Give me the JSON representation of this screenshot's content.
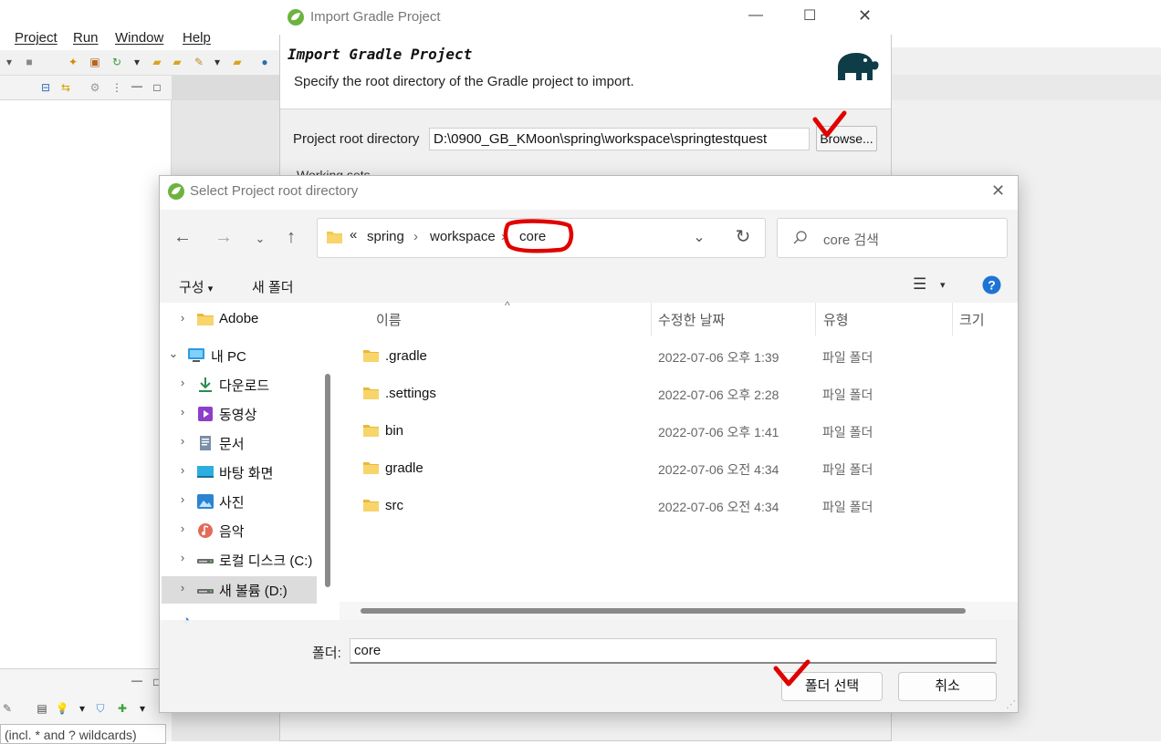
{
  "eclipse": {
    "menu": [
      "Project",
      "Run",
      "Window",
      "Help"
    ],
    "filter_text": "(incl. * and ? wildcards)"
  },
  "gradle_dialog": {
    "title": "Import Gradle Project",
    "heading": "Import Gradle Project",
    "description": "Specify the root directory of the Gradle project to import.",
    "root_label": "Project root directory",
    "root_value": "D:\\0900_GB_KMoon\\spring\\workspace\\springtestquest",
    "browse_label": "Browse...",
    "working_sets_label": "Working sets"
  },
  "folder_dialog": {
    "title": "Select Project root directory",
    "breadcrumb": {
      "overflow": "«",
      "items": [
        "spring",
        "workspace",
        "core"
      ]
    },
    "search_placeholder": "core 검색",
    "organize_label": "구성",
    "new_folder_label": "새 폴더",
    "nav_tree": [
      {
        "label": "Adobe",
        "icon": "folder-icon",
        "indent": 0
      },
      {
        "label": "내 PC",
        "icon": "computer-icon",
        "indent": 0,
        "expanded": true
      },
      {
        "label": "다운로드",
        "icon": "download-icon",
        "indent": 1
      },
      {
        "label": "동영상",
        "icon": "video-icon",
        "indent": 1
      },
      {
        "label": "문서",
        "icon": "document-icon",
        "indent": 1
      },
      {
        "label": "바탕 화면",
        "icon": "desktop-icon",
        "indent": 1
      },
      {
        "label": "사진",
        "icon": "pictures-icon",
        "indent": 1
      },
      {
        "label": "음악",
        "icon": "music-icon",
        "indent": 1
      },
      {
        "label": "로컬 디스크 (C:)",
        "icon": "drive-icon",
        "indent": 1
      },
      {
        "label": "새 볼륨 (D:)",
        "icon": "drive-icon",
        "indent": 1,
        "selected": true
      }
    ],
    "columns": [
      "이름",
      "수정한 날짜",
      "유형",
      "크기"
    ],
    "files": [
      {
        "name": ".gradle",
        "date": "2022-07-06 오후 1:39",
        "type": "파일 폴더"
      },
      {
        "name": ".settings",
        "date": "2022-07-06 오후 2:28",
        "type": "파일 폴더"
      },
      {
        "name": "bin",
        "date": "2022-07-06 오후 1:41",
        "type": "파일 폴더"
      },
      {
        "name": "gradle",
        "date": "2022-07-06 오전 4:34",
        "type": "파일 폴더"
      },
      {
        "name": "src",
        "date": "2022-07-06 오전 4:34",
        "type": "파일 폴더"
      }
    ],
    "folder_label": "폴더:",
    "folder_value": "core",
    "select_button": "폴더 선택",
    "cancel_button": "취소"
  },
  "colors": {
    "annotation_red": "#e00000",
    "folder_yellow": "#f2c94c",
    "help_blue": "#1e74d4",
    "spring_green": "#6db33f"
  }
}
